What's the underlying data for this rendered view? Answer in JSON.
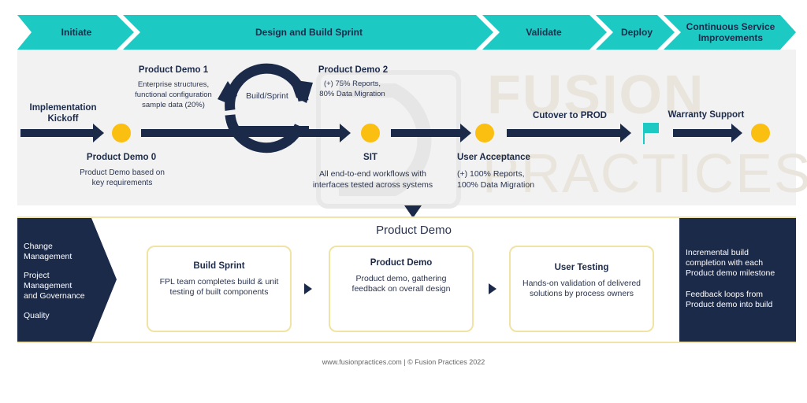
{
  "phases": [
    {
      "label": "Initiate"
    },
    {
      "label": "Design and Build Sprint"
    },
    {
      "label": "Validate"
    },
    {
      "label": "Deploy"
    },
    {
      "label": "Continuous Service Improvements"
    }
  ],
  "colors": {
    "teal": "#1cc9c3",
    "navy": "#1c2a4a",
    "milestone": "#fbbf11",
    "band": "#f2f2f2",
    "card_border": "#f1e3a3"
  },
  "watermark": {
    "line1": "FUSION",
    "line2": "PRACTICES"
  },
  "timeline": {
    "kickoff": {
      "line1": "Implementation",
      "line2": "Kickoff"
    },
    "demo0": {
      "title": "Product Demo 0",
      "desc1": "Product Demo based on",
      "desc2": "key requirements"
    },
    "demo1": {
      "title": "Product Demo 1",
      "desc1": "Enterprise structures,",
      "desc2": "functional configuration",
      "desc3": "sample data (20%)"
    },
    "loop_label": "Build/Sprint",
    "demo2": {
      "title": "Product Demo 2",
      "desc1": "(+) 75% Reports,",
      "desc2": "80% Data Migration"
    },
    "sit": {
      "title": "SIT",
      "desc1": "All end-to-end workflows with",
      "desc2": "interfaces tested across systems"
    },
    "uat": {
      "title": "User Acceptance",
      "desc1": "(+) 100% Reports,",
      "desc2": "100% Data Migration"
    },
    "cutover": {
      "title": "Cutover to PROD"
    },
    "warranty": {
      "title": "Warranty Support"
    }
  },
  "product_demo_section": {
    "title": "Product Demo",
    "left_items": [
      "Change Management",
      "Project Management and Governance",
      "Quality"
    ],
    "left_lines": [
      [
        "Change",
        "Management"
      ],
      [
        "Project",
        "Management",
        "and Governance"
      ],
      [
        "Quality"
      ]
    ],
    "cards": [
      {
        "title": "Build Sprint",
        "desc": "FPL team completes  build & unit testing of built components"
      },
      {
        "title": "Product Demo",
        "desc": "Product demo, gathering feedback on overall design"
      },
      {
        "title": "User Testing",
        "desc": "Hands-on validation of delivered solutions by process owners"
      }
    ],
    "right_notes": [
      "Incremental build completion with each Product demo milestone",
      "Feedback loops from Product demo into build"
    ]
  },
  "footer": {
    "text": "www.fusionpractices.com  |  © Fusion Practices 2022"
  }
}
